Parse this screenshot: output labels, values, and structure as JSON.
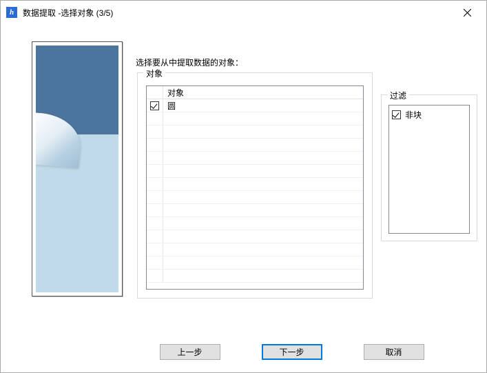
{
  "window": {
    "title": "数据提取 -选择对象 (3/5)"
  },
  "instruction": "选择要从中提取数据的对象：",
  "objects_group": {
    "legend": "对象",
    "header": "对象",
    "rows": [
      {
        "label": "圆",
        "checked": true
      }
    ],
    "empty_rows": 13
  },
  "filter_group": {
    "legend": "过滤",
    "items": [
      {
        "label": "非块",
        "checked": true
      }
    ]
  },
  "buttons": {
    "back": "上一步",
    "next": "下一步",
    "cancel": "取消"
  }
}
